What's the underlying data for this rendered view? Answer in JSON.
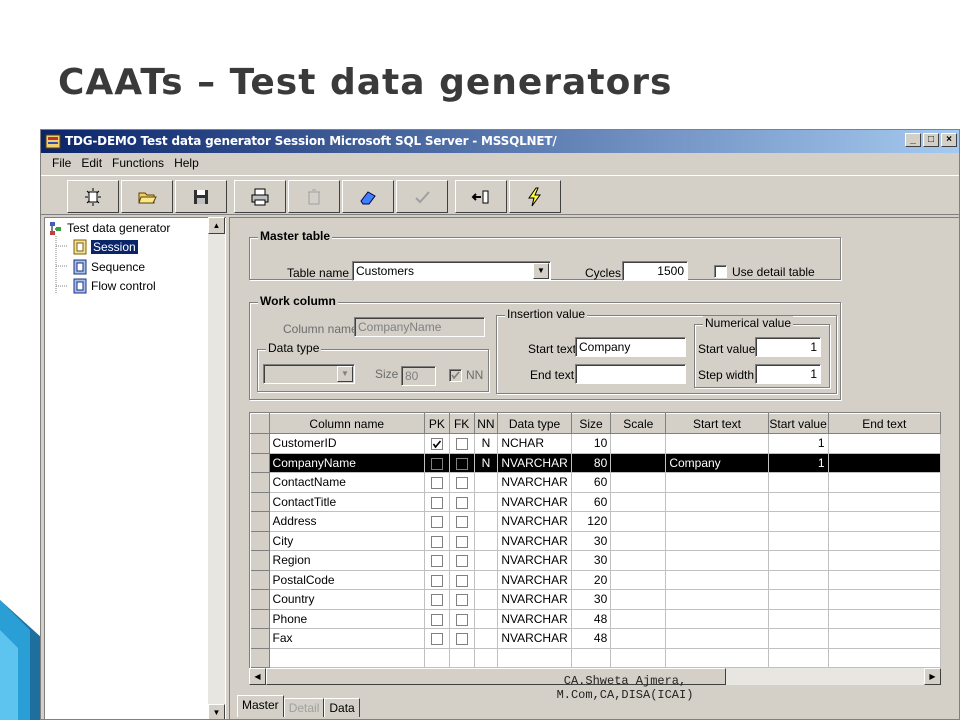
{
  "slide": {
    "title": "CAATs – Test data generators",
    "footer_line1": "CA.Shweta Ajmera,",
    "footer_line2": "M.Com,CA,DISA(ICAI)"
  },
  "window": {
    "title": "TDG-DEMO Test data generator Session  Microsoft SQL Server - MSSQLNET/",
    "minimize": "_",
    "maximize": "□",
    "close": "×"
  },
  "menu": [
    "File",
    "Edit",
    "Functions",
    "Help"
  ],
  "toolbar": [
    {
      "icon": "new-session-icon"
    },
    {
      "icon": "open-folder-icon"
    },
    {
      "icon": "save-disk-icon"
    },
    {
      "icon": "print-icon"
    },
    {
      "icon": "trash-icon"
    },
    {
      "icon": "eraser-icon"
    },
    {
      "icon": "check-icon"
    },
    {
      "icon": "export-icon"
    },
    {
      "icon": "lightning-icon"
    }
  ],
  "tree": {
    "root": "Test data generator",
    "items": [
      "Session",
      "Sequence",
      "Flow control"
    ],
    "selected": "Session"
  },
  "master_table": {
    "group_label": "Master table",
    "table_name_label": "Table name",
    "table_name_value": "Customers",
    "cycles_label": "Cycles",
    "cycles_value": "1500",
    "use_detail_label": "Use detail table"
  },
  "work_column": {
    "group_label": "Work column",
    "column_name_label": "Column name",
    "column_name_value": "CompanyName",
    "data_type_group": "Data type",
    "size_label": "Size",
    "size_value": "80",
    "nn_label": "NN"
  },
  "insertion_value": {
    "group_label": "Insertion value",
    "start_text_label": "Start text",
    "start_text_value": "Company",
    "end_text_label": "End text",
    "end_text_value": ""
  },
  "numerical_value": {
    "group_label": "Numerical value",
    "start_value_label": "Start value",
    "start_value": "1",
    "step_width_label": "Step width",
    "step_width": "1"
  },
  "grid": {
    "columns": [
      "Column name",
      "PK",
      "FK",
      "NN",
      "Data type",
      "Size",
      "Scale",
      "Start text",
      "Start value",
      "End text"
    ],
    "rows": [
      {
        "name": "CustomerID",
        "pk": true,
        "fk": false,
        "nn": "N",
        "type": "NCHAR",
        "size": "10",
        "scale": "",
        "start_text": "",
        "start_value": "1",
        "end_text": ""
      },
      {
        "name": "CompanyName",
        "pk": false,
        "fk": false,
        "nn": "N",
        "type": "NVARCHAR",
        "size": "80",
        "scale": "",
        "start_text": "Company",
        "start_value": "1",
        "end_text": "",
        "selected": true
      },
      {
        "name": "ContactName",
        "pk": false,
        "fk": false,
        "nn": "",
        "type": "NVARCHAR",
        "size": "60",
        "scale": "",
        "start_text": "",
        "start_value": "",
        "end_text": ""
      },
      {
        "name": "ContactTitle",
        "pk": false,
        "fk": false,
        "nn": "",
        "type": "NVARCHAR",
        "size": "60",
        "scale": "",
        "start_text": "",
        "start_value": "",
        "end_text": ""
      },
      {
        "name": "Address",
        "pk": false,
        "fk": false,
        "nn": "",
        "type": "NVARCHAR",
        "size": "120",
        "scale": "",
        "start_text": "",
        "start_value": "",
        "end_text": ""
      },
      {
        "name": "City",
        "pk": false,
        "fk": false,
        "nn": "",
        "type": "NVARCHAR",
        "size": "30",
        "scale": "",
        "start_text": "",
        "start_value": "",
        "end_text": ""
      },
      {
        "name": "Region",
        "pk": false,
        "fk": false,
        "nn": "",
        "type": "NVARCHAR",
        "size": "30",
        "scale": "",
        "start_text": "",
        "start_value": "",
        "end_text": ""
      },
      {
        "name": "PostalCode",
        "pk": false,
        "fk": false,
        "nn": "",
        "type": "NVARCHAR",
        "size": "20",
        "scale": "",
        "start_text": "",
        "start_value": "",
        "end_text": ""
      },
      {
        "name": "Country",
        "pk": false,
        "fk": false,
        "nn": "",
        "type": "NVARCHAR",
        "size": "30",
        "scale": "",
        "start_text": "",
        "start_value": "",
        "end_text": ""
      },
      {
        "name": "Phone",
        "pk": false,
        "fk": false,
        "nn": "",
        "type": "NVARCHAR",
        "size": "48",
        "scale": "",
        "start_text": "",
        "start_value": "",
        "end_text": ""
      },
      {
        "name": "Fax",
        "pk": false,
        "fk": false,
        "nn": "",
        "type": "NVARCHAR",
        "size": "48",
        "scale": "",
        "start_text": "",
        "start_value": "",
        "end_text": ""
      }
    ]
  },
  "tabs": [
    {
      "label": "Master",
      "active": true,
      "disabled": false
    },
    {
      "label": "Detail",
      "active": false,
      "disabled": true
    },
    {
      "label": "Data",
      "active": false,
      "disabled": false
    }
  ],
  "colors": {
    "titlebar_start": "#0a246a",
    "titlebar_end": "#a6caf0",
    "window_bg": "#d4d0c8",
    "selection_bg": "#000000",
    "deco_blue": "#1c8fc8"
  }
}
